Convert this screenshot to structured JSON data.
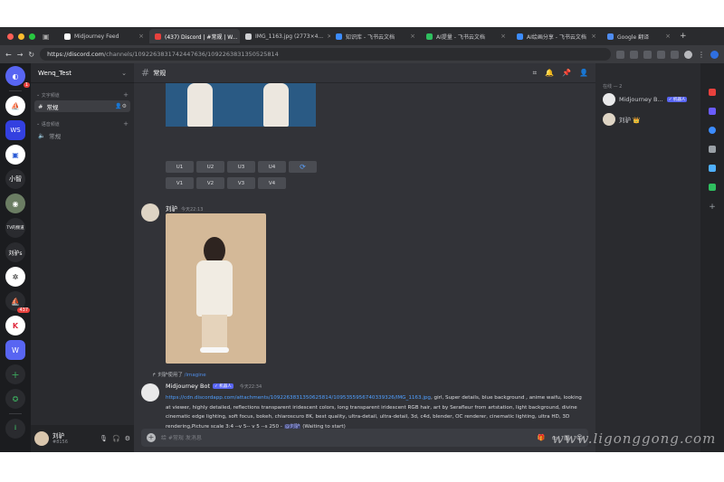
{
  "browser": {
    "tabs": [
      {
        "title": "Midjourney Feed",
        "color": "#ffffff"
      },
      {
        "title": "(437) Discord | #常规 | W...",
        "color": "#e8413d",
        "active": true
      },
      {
        "title": "IMG_1163.jpg (2773×4...",
        "color": "#cfd0d3"
      },
      {
        "title": "知识库 - 飞书云文档",
        "color": "#3c8cff"
      },
      {
        "title": "AI提量 - 飞书云文档",
        "color": "#2fbf5f"
      },
      {
        "title": "AI绘画分享 - 飞书云文档",
        "color": "#3c8cff"
      },
      {
        "title": "Google 翻译",
        "color": "#4f8cf0"
      }
    ],
    "url_host": "https://discord.com",
    "url_path": "/channels/1092263831742447636/1092263831350525814"
  },
  "guild_badges": {
    "discord": "1",
    "server": "437"
  },
  "guild_labels": {
    "xiao": "小智",
    "video": "TV的频道",
    "liu": "刘驴s",
    "w": "W"
  },
  "server": {
    "name": "Wenq_Test"
  },
  "channels": {
    "text_category": "文字频道",
    "voice_category": "语音频道",
    "text_channel": "常规",
    "voice_channel": "常规"
  },
  "user": {
    "name": "刘驴",
    "tag": "#8156"
  },
  "main": {
    "channel_title": "常规",
    "upscale_buttons": [
      "U1",
      "U2",
      "U3",
      "U4"
    ],
    "variation_buttons": [
      "V1",
      "V2",
      "V3",
      "V4"
    ],
    "msg1": {
      "author": "刘驴",
      "time": "今天22:13"
    },
    "reply": {
      "user": "刘驴",
      "used": "使用了",
      "command": "/imagine"
    },
    "bot": {
      "name": "Midjourney Bot",
      "tag": "✓ 机器人",
      "time": "今天22:34"
    },
    "bot_link": "https://cdn.discordapp.com/attachments/1092263831350625814/1095355956740339326/IMG_1163.jpg",
    "bot_prompt": ", girl, Super details, blue background , anime waifu, looking at viewer, highly detailed, reflections transparent iridescent colors, long transparent iridescent RGB hair, art by Serafleur from artstation, light background, divine cinematic edge lighting, soft focus, bokeh, chiaroscuro 8K, best quality, ultra-detail, ultra-detail, 3d, c4d, blender, OC renderer, cinematic lighting, ultra HD, 3D rendering,Picture scale 3:4 --v 5-- v 5 --s 250 - ",
    "bot_mention": "@刘驴",
    "bot_status": " (Waiting to start)",
    "input_placeholder": "给 #常规 发消息"
  },
  "members": {
    "heading": "在线 — 2",
    "list": [
      {
        "name": "Midjourney B...",
        "tag": "✓ 机器人",
        "color": "#e9e9ea"
      },
      {
        "name": "刘驴 👑",
        "color": "#ded4c4"
      }
    ]
  },
  "watermark": "www.ligonggong.com"
}
